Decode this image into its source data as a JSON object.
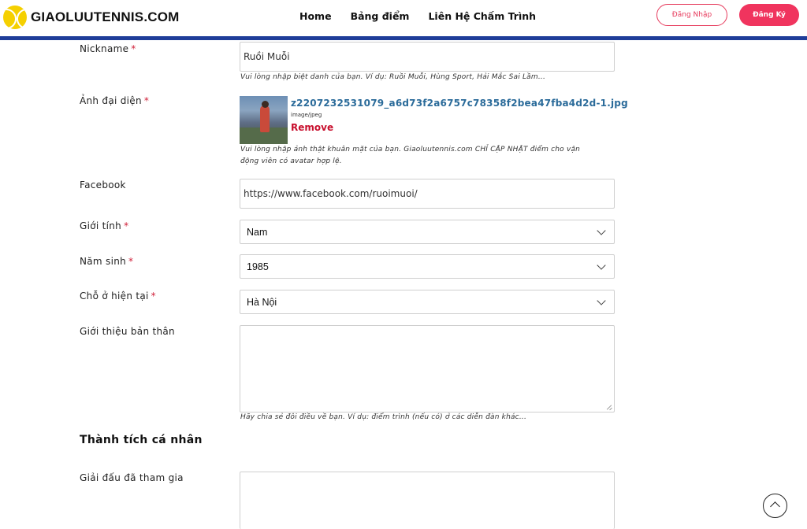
{
  "header": {
    "logo_text": "GIAOLUUTENNIS.COM",
    "nav": [
      "Home",
      "Bảng điểm",
      "Liên Hệ Chấm Trình"
    ],
    "login_label": "Đăng Nhập",
    "register_label": "Đăng Ký",
    "accent_color": "#f0345e",
    "bar_color": "#1f3d99"
  },
  "form": {
    "nickname": {
      "label": "Nickname",
      "required": "*",
      "value": "Ruồi Muỗi",
      "help": "Vui lòng nhập biệt danh của bạn. Ví dụ: Ruồi Muỗi, Hùng Sport, Hải Mắc Sai Lầm..."
    },
    "avatar": {
      "label": "Ảnh đại diện",
      "required": "*",
      "file_name": "z2207232531079_a6d73f2a6757c78358f2bea47fba4d2d-1.jpg",
      "file_type": "image/jpeg",
      "remove_label": "Remove",
      "help_line1": "Vui lòng nhập ảnh thật khuân mặt của bạn. Giaoluutennis.com CHỈ CẬP NHẬT điểm cho vận",
      "help_line2": "động viên có avatar hợp lệ."
    },
    "facebook": {
      "label": "Facebook",
      "value": "https://www.facebook.com/ruoimuoi/"
    },
    "gender": {
      "label": "Giới tính",
      "required": "*",
      "value": "Nam"
    },
    "birth_year": {
      "label": "Năm sinh",
      "required": "*",
      "value": "1985"
    },
    "residence": {
      "label": "Chỗ ở hiện tại",
      "required": "*",
      "value": "Hà Nội"
    },
    "bio": {
      "label": "Giới thiệu bản thân",
      "value": "",
      "help": "Hãy chia sẻ đôi điều về bạn. Ví dụ: điểm trình (nếu có) ở các diễn đàn khác..."
    },
    "achievements": {
      "section_title": "Thành tích cá nhân",
      "tournaments_label": "Giải đấu đã tham gia",
      "tournaments_value": ""
    }
  }
}
